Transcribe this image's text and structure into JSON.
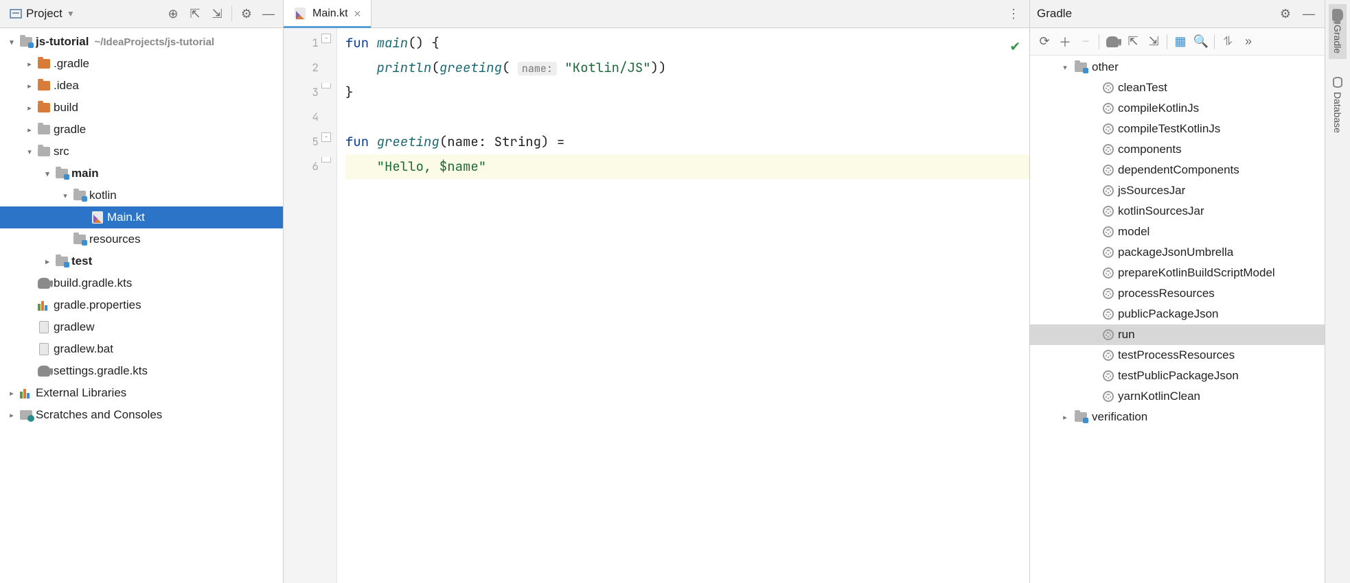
{
  "project": {
    "title": "Project",
    "root": {
      "name": "js-tutorial",
      "hint": "~/IdeaProjects/js-tutorial"
    },
    "tree": [
      {
        "name": ".gradle",
        "type": "folder-orange",
        "depth": 1,
        "chev": "right"
      },
      {
        "name": ".idea",
        "type": "folder-orange",
        "depth": 1,
        "chev": "right"
      },
      {
        "name": "build",
        "type": "folder-orange",
        "depth": 1,
        "chev": "right"
      },
      {
        "name": "gradle",
        "type": "folder-gray",
        "depth": 1,
        "chev": "right"
      },
      {
        "name": "src",
        "type": "folder-gray",
        "depth": 1,
        "chev": "down"
      },
      {
        "name": "main",
        "type": "folder-blue",
        "depth": 2,
        "chev": "down",
        "bold": true
      },
      {
        "name": "kotlin",
        "type": "folder-blue",
        "depth": 3,
        "chev": "down"
      },
      {
        "name": "Main.kt",
        "type": "file-kt",
        "depth": 4,
        "chev": "",
        "selected": true
      },
      {
        "name": "resources",
        "type": "folder-blue",
        "depth": 3,
        "chev": ""
      },
      {
        "name": "test",
        "type": "folder-blue",
        "depth": 2,
        "chev": "right",
        "bold": true
      },
      {
        "name": "build.gradle.kts",
        "type": "elephant",
        "depth": 1,
        "chev": ""
      },
      {
        "name": "gradle.properties",
        "type": "libs",
        "depth": 1,
        "chev": ""
      },
      {
        "name": "gradlew",
        "type": "file",
        "depth": 1,
        "chev": ""
      },
      {
        "name": "gradlew.bat",
        "type": "file",
        "depth": 1,
        "chev": ""
      },
      {
        "name": "settings.gradle.kts",
        "type": "elephant",
        "depth": 1,
        "chev": ""
      }
    ],
    "external": "External Libraries",
    "scratches": "Scratches and Consoles"
  },
  "editor": {
    "tab_name": "Main.kt",
    "lines": [
      "1",
      "2",
      "3",
      "4",
      "5",
      "6"
    ],
    "code": {
      "l1_kw": "fun",
      "l1_fn": "main",
      "l1_rest": "() {",
      "l2_fn1": "println",
      "l2_fn2": "greeting",
      "l2_hint": "name:",
      "l2_str": "\"Kotlin/JS\"",
      "l3": "}",
      "l5_kw": "fun",
      "l5_fn": "greeting",
      "l5_sig": "(name: String) =",
      "l6_str": "\"Hello, $name\""
    }
  },
  "gradle": {
    "title": "Gradle",
    "groups": {
      "other": "other",
      "verification": "verification"
    },
    "tasks": [
      "cleanTest",
      "compileKotlinJs",
      "compileTestKotlinJs",
      "components",
      "dependentComponents",
      "jsSourcesJar",
      "kotlinSourcesJar",
      "model",
      "packageJsonUmbrella",
      "prepareKotlinBuildScriptModel",
      "processResources",
      "publicPackageJson",
      "run",
      "testProcessResources",
      "testPublicPackageJson",
      "yarnKotlinClean"
    ],
    "selected_task": "run"
  },
  "right_tabs": {
    "gradle": "Gradle",
    "database": "Database"
  }
}
